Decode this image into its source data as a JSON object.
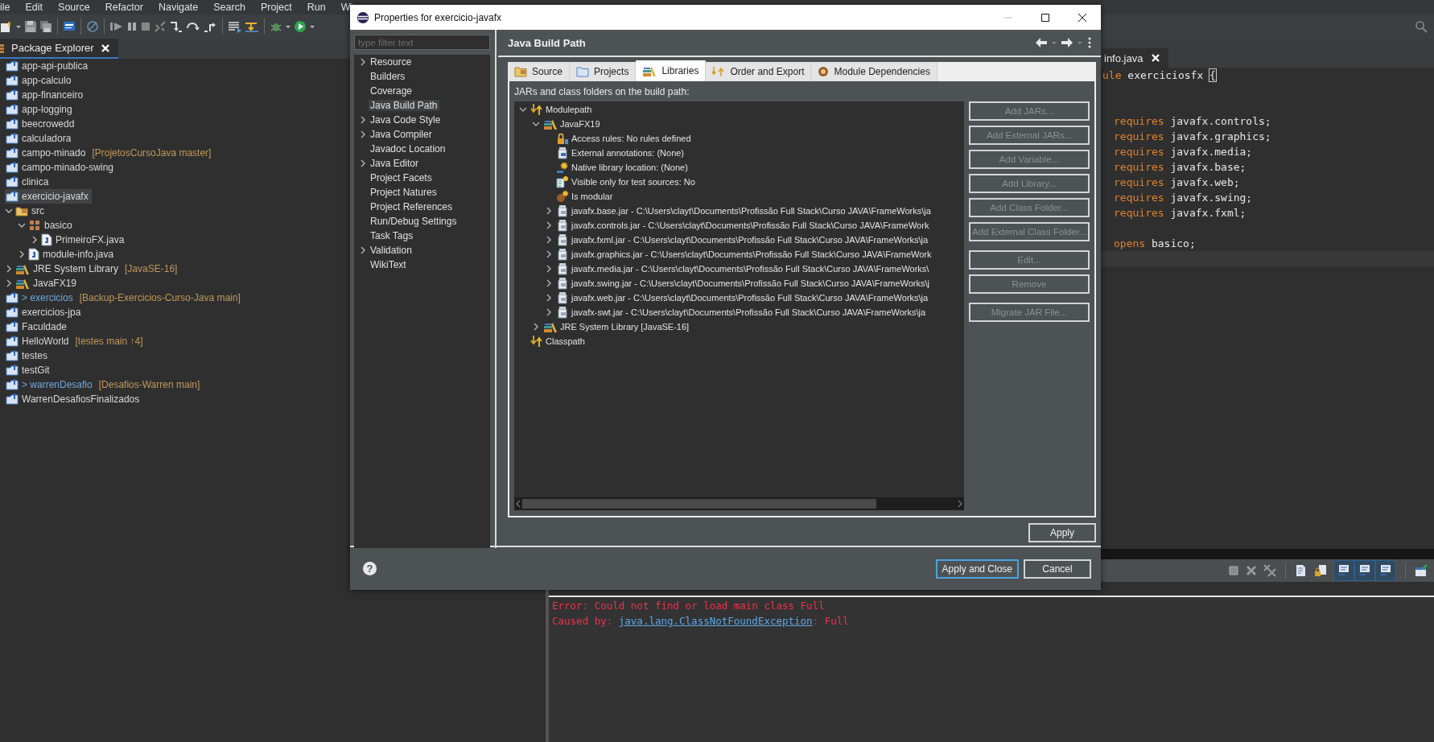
{
  "menu": [
    "ile",
    "Edit",
    "Source",
    "Refactor",
    "Navigate",
    "Search",
    "Project",
    "Run",
    "Wi"
  ],
  "explorer": {
    "title": "Package Explorer",
    "items": [
      {
        "label": "app-api-publica",
        "kind": "project",
        "selected": false,
        "modified": false
      },
      {
        "label": "app-calculo",
        "kind": "project",
        "selected": false,
        "modified": false
      },
      {
        "label": "app-financeiro",
        "kind": "project",
        "selected": false,
        "modified": false
      },
      {
        "label": "app-logging",
        "kind": "project",
        "selected": false,
        "modified": false
      },
      {
        "label": "beecrowedd",
        "kind": "project",
        "selected": false,
        "modified": false
      },
      {
        "label": "calculadora",
        "kind": "project",
        "selected": false,
        "modified": false
      },
      {
        "label": "campo-minado",
        "decoration": "[ProjetosCursoJava master]",
        "kind": "project",
        "selected": false,
        "modified": false
      },
      {
        "label": "campo-minado-swing",
        "kind": "project",
        "selected": false,
        "modified": false
      },
      {
        "label": "clinica",
        "kind": "project",
        "selected": false,
        "modified": false
      },
      {
        "label": "exercicio-javafx",
        "kind": "project",
        "selected": true,
        "modified": false,
        "children": [
          {
            "label": "src",
            "kind": "source-folder",
            "expanded": true,
            "children": [
              {
                "label": "basico",
                "kind": "package",
                "expanded": true,
                "children": [
                  {
                    "label": "PrimeiroFX.java",
                    "kind": "java-file",
                    "expanded": false
                  }
                ]
              },
              {
                "label": "module-info.java",
                "kind": "java-file",
                "expanded": false
              }
            ]
          },
          {
            "label": "JRE System Library",
            "decoration": "[JavaSE-16]",
            "kind": "library",
            "expanded": false
          },
          {
            "label": "JavaFX19",
            "kind": "library",
            "expanded": false
          }
        ]
      },
      {
        "prefix": "> ",
        "label": "exercicios",
        "decoration": "[Backup-Exercicios-Curso-Java main]",
        "kind": "project",
        "selected": false,
        "modified": true
      },
      {
        "label": "exercicios-jpa",
        "kind": "project",
        "selected": false,
        "modified": false
      },
      {
        "label": "Faculdade",
        "kind": "project",
        "selected": false,
        "modified": false
      },
      {
        "label": "HelloWorld",
        "decoration": "[testes main ↑4]",
        "kind": "project",
        "selected": false,
        "modified": false
      },
      {
        "label": "testes",
        "kind": "project",
        "selected": false,
        "modified": false
      },
      {
        "label": "testGit",
        "kind": "project",
        "selected": false,
        "modified": false
      },
      {
        "prefix": "> ",
        "label": "warrenDesafio",
        "decoration": "[Desafios-Warren main]",
        "kind": "project",
        "selected": false,
        "modified": true
      },
      {
        "label": "WarrenDesafiosFinalizados",
        "kind": "project",
        "selected": false,
        "modified": false
      }
    ]
  },
  "editor": {
    "tab": "info.java",
    "lines": [
      {
        "current": false,
        "indented": false,
        "tokens": [
          {
            "text": "ule",
            "kind": "keyword"
          },
          {
            "text": " exerciciosfx ",
            "kind": "plain"
          },
          {
            "text": "{",
            "kind": "bracket"
          }
        ]
      },
      {
        "current": false
      },
      {
        "current": false
      },
      {
        "current": false,
        "indented": true,
        "tokens": [
          {
            "text": "requires",
            "kind": "keyword"
          },
          {
            "text": " javafx.controls;",
            "kind": "plain"
          }
        ]
      },
      {
        "current": false,
        "indented": true,
        "tokens": [
          {
            "text": "requires",
            "kind": "keyword"
          },
          {
            "text": " javafx.graphics;",
            "kind": "plain"
          }
        ]
      },
      {
        "current": false,
        "indented": true,
        "tokens": [
          {
            "text": "requires",
            "kind": "keyword"
          },
          {
            "text": " javafx.media;",
            "kind": "plain"
          }
        ]
      },
      {
        "current": false,
        "indented": true,
        "tokens": [
          {
            "text": "requires",
            "kind": "keyword"
          },
          {
            "text": " javafx.base;",
            "kind": "plain"
          }
        ]
      },
      {
        "current": false,
        "indented": true,
        "tokens": [
          {
            "text": "requires",
            "kind": "keyword"
          },
          {
            "text": " javafx.web;",
            "kind": "plain"
          }
        ]
      },
      {
        "current": false,
        "indented": true,
        "tokens": [
          {
            "text": "requires",
            "kind": "keyword"
          },
          {
            "text": " javafx.swing;",
            "kind": "plain"
          }
        ]
      },
      {
        "current": false,
        "indented": true,
        "tokens": [
          {
            "text": "requires",
            "kind": "keyword"
          },
          {
            "text": " javafx.fxml;",
            "kind": "plain"
          }
        ]
      },
      {
        "current": false
      },
      {
        "current": false,
        "indented": true,
        "tokens": [
          {
            "text": "opens",
            "kind": "keyword"
          },
          {
            "text": " basico;",
            "kind": "plain"
          }
        ]
      },
      {
        "current": true
      }
    ]
  },
  "console": {
    "toggles": [
      {
        "selected": true
      },
      {
        "selected": true
      },
      {
        "selected": true
      }
    ],
    "lines": [
      {
        "parts": [
          {
            "text": "Error: Could not find or load main class Full",
            "kind": "error"
          }
        ]
      },
      {
        "parts": [
          {
            "text": "Caused by: ",
            "kind": "error"
          },
          {
            "text": "java.lang.ClassNotFoundException",
            "kind": "link"
          },
          {
            "text": ": Full",
            "kind": "error"
          }
        ]
      }
    ]
  },
  "dialog": {
    "title": "Properties for exercicio-javafx",
    "filter": {
      "placeholder": "type filter text"
    },
    "pages": [
      {
        "label": "Resource",
        "expanded": false,
        "selected": false
      },
      {
        "label": "Builders",
        "selected": false
      },
      {
        "label": "Coverage",
        "selected": false
      },
      {
        "label": "Java Build Path",
        "selected": true
      },
      {
        "label": "Java Code Style",
        "expanded": false,
        "selected": false
      },
      {
        "label": "Java Compiler",
        "expanded": false,
        "selected": false
      },
      {
        "label": "Javadoc Location",
        "selected": false
      },
      {
        "label": "Java Editor",
        "expanded": false,
        "selected": false
      },
      {
        "label": "Project Facets",
        "selected": false
      },
      {
        "label": "Project Natures",
        "selected": false
      },
      {
        "label": "Project References",
        "selected": false
      },
      {
        "label": "Run/Debug Settings",
        "selected": false
      },
      {
        "label": "Task Tags",
        "selected": false
      },
      {
        "label": "Validation",
        "expanded": false,
        "selected": false
      },
      {
        "label": "WikiText",
        "selected": false
      }
    ],
    "page_title": "Java Build Path",
    "tabs": [
      {
        "label": "Source",
        "selected": false
      },
      {
        "label": "Projects",
        "selected": false
      },
      {
        "label": "Libraries",
        "selected": true
      },
      {
        "label": "Order and Export",
        "selected": false
      },
      {
        "label": "Module Dependencies",
        "selected": false
      }
    ],
    "tree_caption": "JARs and class folders on the build path:",
    "tree": [
      {
        "label": "Modulepath",
        "kind": "path",
        "expanded": true,
        "children": [
          {
            "label": "JavaFX19",
            "kind": "library",
            "expanded": true,
            "children": [
              {
                "label": "Access rules: No rules defined",
                "kind": "access"
              },
              {
                "label": "External annotations: (None)",
                "kind": "annotations"
              },
              {
                "label": "Native library location: (None)",
                "kind": "native"
              },
              {
                "label": "Visible only for test sources: No",
                "kind": "test"
              },
              {
                "label": "Is modular",
                "kind": "modular"
              },
              {
                "label": "javafx.base.jar - C:\\Users\\clayt\\Documents\\Profissão Full Stack\\Curso JAVA\\FrameWorks\\ja",
                "kind": "jar",
                "expanded": false
              },
              {
                "label": "javafx.controls.jar - C:\\Users\\clayt\\Documents\\Profissão Full Stack\\Curso JAVA\\FrameWork",
                "kind": "jar",
                "expanded": false
              },
              {
                "label": "javafx.fxml.jar - C:\\Users\\clayt\\Documents\\Profissão Full Stack\\Curso JAVA\\FrameWorks\\ja",
                "kind": "jar",
                "expanded": false
              },
              {
                "label": "javafx.graphics.jar - C:\\Users\\clayt\\Documents\\Profissão Full Stack\\Curso JAVA\\FrameWork",
                "kind": "jar",
                "expanded": false
              },
              {
                "label": "javafx.media.jar - C:\\Users\\clayt\\Documents\\Profissão Full Stack\\Curso JAVA\\FrameWorks\\",
                "kind": "jar",
                "expanded": false
              },
              {
                "label": "javafx.swing.jar - C:\\Users\\clayt\\Documents\\Profissão Full Stack\\Curso JAVA\\FrameWorks\\j",
                "kind": "jar",
                "expanded": false
              },
              {
                "label": "javafx.web.jar - C:\\Users\\clayt\\Documents\\Profissão Full Stack\\Curso JAVA\\FrameWorks\\ja",
                "kind": "jar",
                "expanded": false
              },
              {
                "label": "javafx-swt.jar - C:\\Users\\clayt\\Documents\\Profissão Full Stack\\Curso JAVA\\FrameWorks\\ja",
                "kind": "jar",
                "expanded": false
              }
            ]
          },
          {
            "label": "JRE System Library [JavaSE-16]",
            "kind": "library",
            "expanded": false
          }
        ]
      },
      {
        "label": "Classpath",
        "kind": "path"
      }
    ],
    "button_groups": [
      {
        "buttons": [
          {
            "label": "Add JARs...",
            "disabled": true
          },
          {
            "label": "Add External JARs...",
            "disabled": true
          },
          {
            "label": "Add Variable...",
            "disabled": true
          },
          {
            "label": "Add Library...",
            "disabled": true
          },
          {
            "label": "Add Class Folder...",
            "disabled": true
          },
          {
            "label": "Add External Class Folder...",
            "disabled": true
          }
        ]
      },
      {
        "buttons": [
          {
            "label": "Edit...",
            "disabled": true
          },
          {
            "label": "Remove",
            "disabled": true
          }
        ]
      },
      {
        "buttons": [
          {
            "label": "Migrate JAR File...",
            "disabled": true
          }
        ]
      }
    ],
    "apply": "Apply",
    "help": "?",
    "buttons": [
      {
        "label": "Apply and Close",
        "default": true
      },
      {
        "label": "Cancel",
        "default": false
      }
    ]
  }
}
